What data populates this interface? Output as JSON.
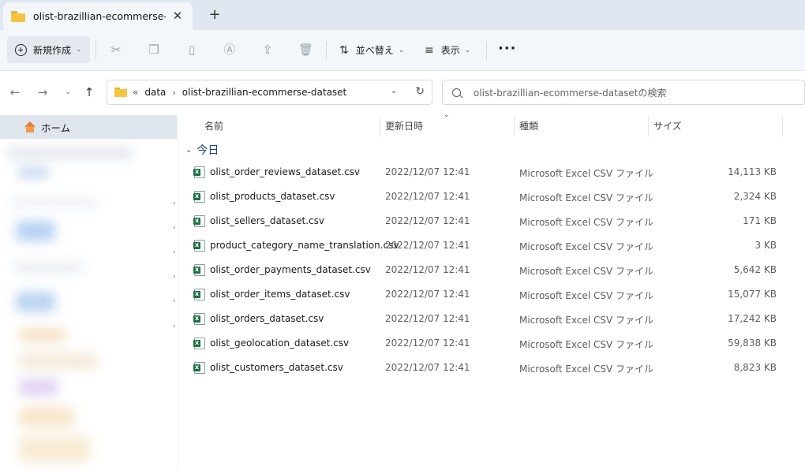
{
  "tab": {
    "title": "olist-brazillian-ecommerse-dataset",
    "close": "✕",
    "new_tab": "+"
  },
  "toolbar": {
    "new_label": "新規作成",
    "sort_label": "並べ替え",
    "view_label": "表示",
    "more": "···"
  },
  "address": {
    "overflow": "«",
    "crumbs": [
      "data",
      "olist-brazillian-ecommerse-dataset"
    ],
    "separator": "›"
  },
  "search": {
    "placeholder": "olist-brazillian-ecommerse-datasetの検索"
  },
  "sidebar": {
    "home_label": "ホーム"
  },
  "columns": {
    "name": "名前",
    "modified": "更新日時",
    "type": "種類",
    "size": "サイズ"
  },
  "group": {
    "label": "今日"
  },
  "files": [
    {
      "name": "olist_order_reviews_dataset.csv",
      "modified": "2022/12/07 12:41",
      "type": "Microsoft Excel CSV ファイル",
      "size": "14,113 KB"
    },
    {
      "name": "olist_products_dataset.csv",
      "modified": "2022/12/07 12:41",
      "type": "Microsoft Excel CSV ファイル",
      "size": "2,324 KB"
    },
    {
      "name": "olist_sellers_dataset.csv",
      "modified": "2022/12/07 12:41",
      "type": "Microsoft Excel CSV ファイル",
      "size": "171 KB"
    },
    {
      "name": "product_category_name_translation.csv",
      "modified": "2022/12/07 12:41",
      "type": "Microsoft Excel CSV ファイル",
      "size": "3 KB"
    },
    {
      "name": "olist_order_payments_dataset.csv",
      "modified": "2022/12/07 12:41",
      "type": "Microsoft Excel CSV ファイル",
      "size": "5,642 KB"
    },
    {
      "name": "olist_order_items_dataset.csv",
      "modified": "2022/12/07 12:41",
      "type": "Microsoft Excel CSV ファイル",
      "size": "15,077 KB"
    },
    {
      "name": "olist_orders_dataset.csv",
      "modified": "2022/12/07 12:41",
      "type": "Microsoft Excel CSV ファイル",
      "size": "17,242 KB"
    },
    {
      "name": "olist_geolocation_dataset.csv",
      "modified": "2022/12/07 12:41",
      "type": "Microsoft Excel CSV ファイル",
      "size": "59,838 KB"
    },
    {
      "name": "olist_customers_dataset.csv",
      "modified": "2022/12/07 12:41",
      "type": "Microsoft Excel CSV ファイル",
      "size": "8,823 KB"
    }
  ],
  "colors": {
    "tabstrip": "#dfe7f1",
    "commandbar": "#f3f6fa",
    "group_header": "#1f3f78",
    "excel_green": "#1d7244"
  },
  "icons": {
    "cut": "cut-icon",
    "copy": "copy-icon",
    "paste": "paste-icon",
    "rename": "rename-icon",
    "share": "share-icon",
    "delete": "trash-icon",
    "sort": "sort-icon",
    "view": "view-icon"
  }
}
